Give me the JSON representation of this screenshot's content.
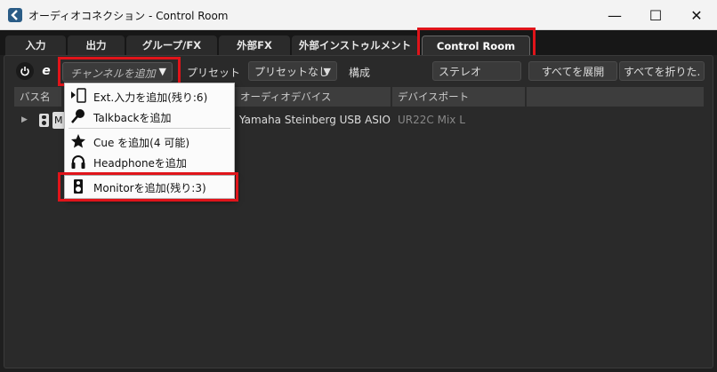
{
  "window": {
    "title": "オーディオコネクション - Control Room",
    "minimize_glyph": "—",
    "maximize_glyph": "☐",
    "close_glyph": "✕"
  },
  "tabs": [
    {
      "label": "入力"
    },
    {
      "label": "出力"
    },
    {
      "label": "グループ/FX"
    },
    {
      "label": "外部FX"
    },
    {
      "label": "外部インストゥルメント"
    },
    {
      "label": "Control Room"
    }
  ],
  "toolbar": {
    "power_icon": "power-icon",
    "edit_icon": "e-icon",
    "channel_add_placeholder": "チャンネルを追加",
    "dropdown_arrow": "▼",
    "preset_label": "プリセット",
    "preset_value": "プリセットなし",
    "config_label": "構成",
    "config_value": "ステレオ",
    "expand_all": "すべてを展開",
    "collapse_all": "すべてを折りた."
  },
  "columns": {
    "bus_name": "バス名",
    "audio_device": "オーディオデバイス",
    "device_port": "デバイスポート"
  },
  "row": {
    "bus_badge": "M",
    "audio_device": "Yamaha Steinberg USB ASIO",
    "device_port": "UR22C Mix L"
  },
  "menu": {
    "items": [
      {
        "label": "Ext.入力を追加(残り:6)",
        "icon": "ext-input-icon"
      },
      {
        "label": "Talkbackを追加",
        "icon": "microphone-icon"
      },
      {
        "label": "Cue を追加(4 可能)",
        "icon": "star-icon"
      },
      {
        "label": "Headphoneを追加",
        "icon": "headphone-icon"
      },
      {
        "label": "Monitorを追加(残り:3)",
        "icon": "speaker-icon"
      }
    ]
  },
  "colors": {
    "highlight": "#e0141a",
    "background": "#2a2a2a",
    "menu_background": "#fbfbfb"
  }
}
